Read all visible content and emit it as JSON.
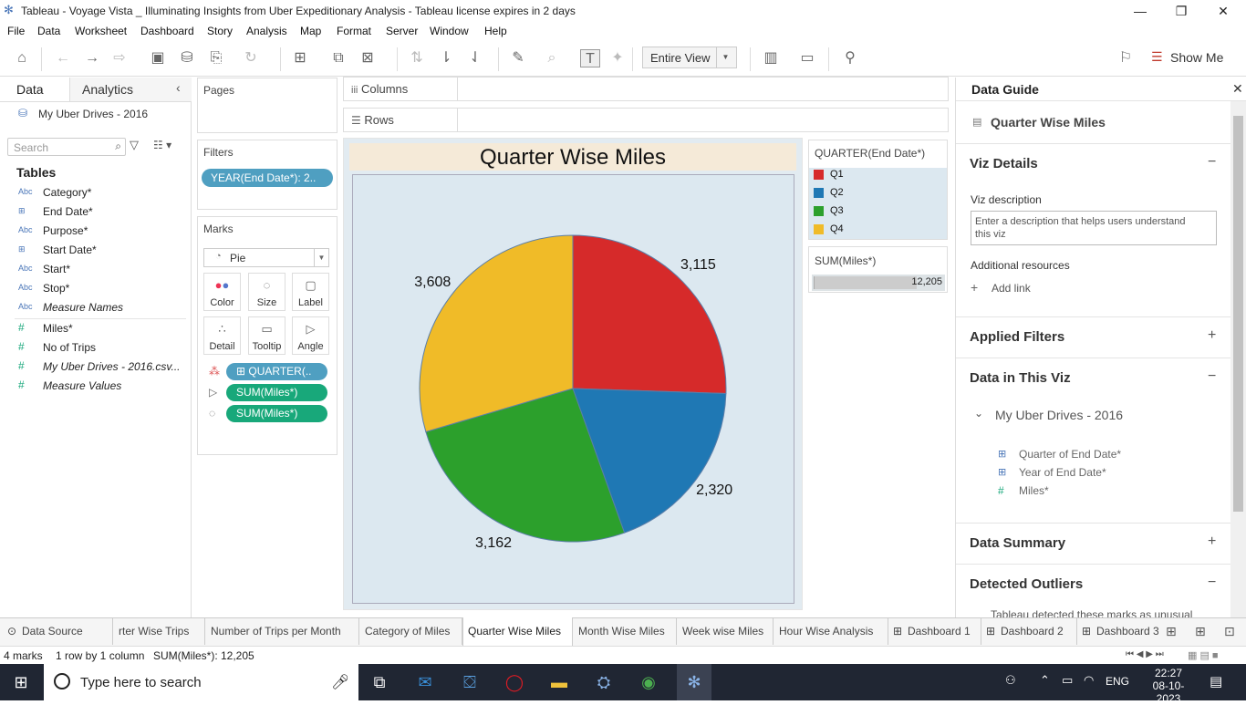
{
  "window": {
    "title": "Tableau - Voyage Vista _ Illuminating Insights from Uber Expeditionary Analysis - Tableau license expires in 2 days",
    "minimize": "—",
    "restore": "❐",
    "close": "✕"
  },
  "menu": [
    "File",
    "Data",
    "Worksheet",
    "Dashboard",
    "Story",
    "Analysis",
    "Map",
    "Format",
    "Server",
    "Window",
    "Help"
  ],
  "toolbar": {
    "fit_value": "Entire View",
    "show_me": "Show Me"
  },
  "left_pane": {
    "tabs": [
      "Data",
      "Analytics"
    ],
    "data_source": "My Uber Drives - 2016",
    "search_placeholder": "Search",
    "tables_label": "Tables",
    "fields": [
      {
        "type": "Abc",
        "name": "Category*",
        "measure": false
      },
      {
        "type": "date",
        "name": "End Date*",
        "measure": false
      },
      {
        "type": "Abc",
        "name": "Purpose*",
        "measure": false
      },
      {
        "type": "date",
        "name": "Start Date*",
        "measure": false
      },
      {
        "type": "Abc",
        "name": "Start*",
        "measure": false
      },
      {
        "type": "Abc",
        "name": "Stop*",
        "measure": false
      },
      {
        "type": "Abc",
        "name": "Measure Names",
        "measure": false
      },
      {
        "type": "#",
        "name": "Miles*",
        "measure": true
      },
      {
        "type": "#",
        "name": "No of Trips",
        "measure": true
      },
      {
        "type": "#",
        "name": "My Uber Drives - 2016.csv...",
        "measure": true
      },
      {
        "type": "#",
        "name": "Measure Values",
        "measure": true
      }
    ]
  },
  "cards": {
    "pages": "Pages",
    "filters": "Filters",
    "filter_pill": "YEAR(End Date*): 2..",
    "marks": "Marks",
    "mark_type": "Pie",
    "mark_buttons": [
      "Color",
      "Size",
      "Label",
      "Detail",
      "Tooltip",
      "Angle"
    ],
    "mark_pills": [
      "QUARTER(..",
      "SUM(Miles*)",
      "SUM(Miles*)"
    ]
  },
  "shelves": {
    "columns": "Columns",
    "rows": "Rows"
  },
  "chart_data": {
    "type": "pie",
    "title": "Quarter Wise Miles",
    "categories": [
      "Q1",
      "Q2",
      "Q3",
      "Q4"
    ],
    "values": [
      3115,
      2320,
      3162,
      3608
    ],
    "labels": [
      "3,115",
      "2,320",
      "3,162",
      "3,608"
    ],
    "colors": [
      "#d62a2a",
      "#1f78b4",
      "#2ca02c",
      "#f0bb28"
    ],
    "legend_title": "QUARTER(End Date*)",
    "size_legend_title": "SUM(Miles*)",
    "total_label": "12,205"
  },
  "guide": {
    "title": "Data Guide",
    "close": "✕",
    "viz_name": "Quarter Wise Miles",
    "viz_details": "Viz Details",
    "viz_description_label": "Viz description",
    "viz_description_placeholder": "Enter a description that helps users understand this viz",
    "additional_resources": "Additional resources",
    "add_link": "Add link",
    "applied_filters": "Applied Filters",
    "data_in_viz": "Data in This Viz",
    "datasource": "My Uber Drives - 2016",
    "fields": [
      "Quarter of End Date*",
      "Year of End Date*",
      "Miles*"
    ],
    "data_summary": "Data Summary",
    "detected_outliers": "Detected Outliers",
    "outliers_text": "Tableau detected these marks as unusual"
  },
  "sheet_tabs": [
    "Data Source",
    "rter Wise Trips",
    "Number of Trips per Month",
    "Category of Miles",
    "Quarter Wise Miles",
    "Month Wise Miles",
    "Week wise Miles",
    "Hour Wise Analysis",
    "Dashboard 1",
    "Dashboard 2",
    "Dashboard 3"
  ],
  "status": {
    "marks": "4 marks",
    "dims": "1 row by 1 column",
    "sum": "SUM(Miles*): 12,205"
  },
  "taskbar": {
    "search_placeholder": "Type here to search",
    "lang": "ENG",
    "time": "22:27",
    "date": "08-10-2023"
  }
}
